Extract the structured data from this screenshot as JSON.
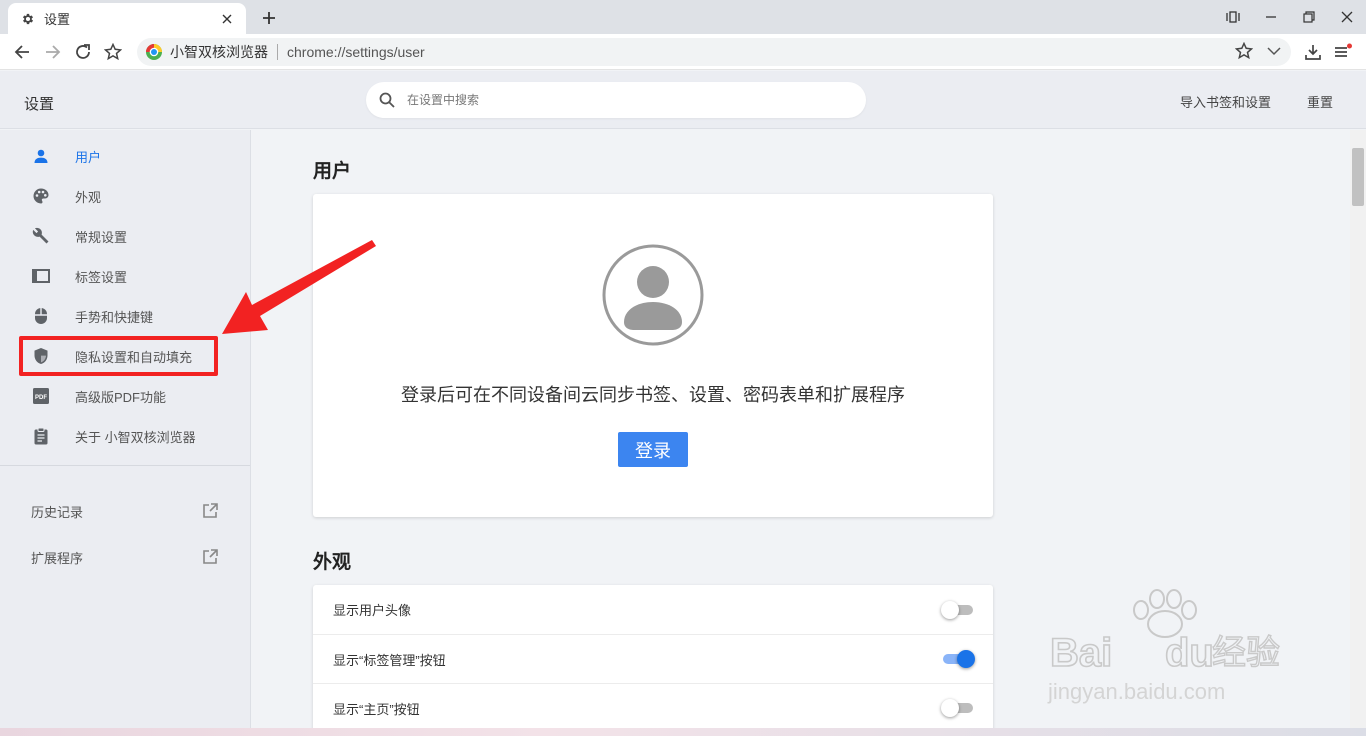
{
  "tab": {
    "title": "设置"
  },
  "toolbar": {
    "site_name": "小智双核浏览器",
    "url": "chrome://settings/user"
  },
  "header": {
    "title": "设置",
    "search_placeholder": "在设置中搜索",
    "import_label": "导入书签和设置",
    "reset_label": "重置"
  },
  "sidebar": {
    "items": [
      {
        "label": "用户",
        "icon": "person-icon"
      },
      {
        "label": "外观",
        "icon": "palette-icon"
      },
      {
        "label": "常规设置",
        "icon": "wrench-icon"
      },
      {
        "label": "标签设置",
        "icon": "tab-icon"
      },
      {
        "label": "手势和快捷键",
        "icon": "mouse-icon"
      },
      {
        "label": "隐私设置和自动填充",
        "icon": "shield-icon"
      },
      {
        "label": "高级版PDF功能",
        "icon": "pdf-icon"
      },
      {
        "label": "关于 小智双核浏览器",
        "icon": "clipboard-icon"
      }
    ],
    "external": [
      {
        "label": "历史记录",
        "icon": "open-external-icon"
      },
      {
        "label": "扩展程序",
        "icon": "open-external-icon"
      }
    ]
  },
  "main": {
    "user_section": {
      "title": "用户",
      "signin_text": "登录后可在不同设备间云同步书签、设置、密码表单和扩展程序",
      "signin_button": "登录"
    },
    "appearance_section": {
      "title": "外观",
      "options": [
        {
          "label": "显示用户头像",
          "enabled": false
        },
        {
          "label": "显示“标签管理”按钮",
          "enabled": true
        },
        {
          "label": "显示“主页”按钮",
          "enabled": false
        }
      ]
    }
  },
  "watermark": {
    "brand": "Baidu经验",
    "site": "jingyan.baidu.com"
  },
  "colors": {
    "accent": "#1a73e8",
    "signin_button": "#3c85f0",
    "highlight": "#f22222"
  }
}
